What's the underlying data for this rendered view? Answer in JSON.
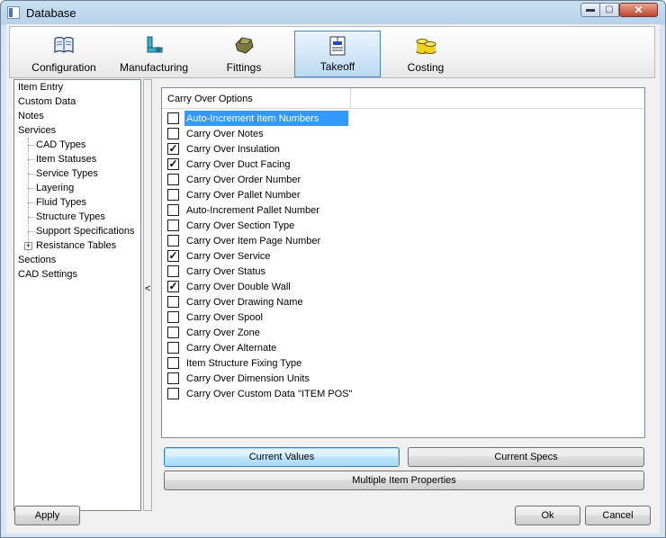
{
  "window": {
    "title": "Database"
  },
  "titlebar_buttons": {
    "minimize": "▬",
    "maximize": "▢",
    "close": "✕"
  },
  "tabs": [
    {
      "label": "Configuration",
      "icon": "book-icon"
    },
    {
      "label": "Manufacturing",
      "icon": "machine-icon"
    },
    {
      "label": "Fittings",
      "icon": "fitting-icon"
    },
    {
      "label": "Takeoff",
      "icon": "takeoff-icon",
      "active": true
    },
    {
      "label": "Costing",
      "icon": "coins-icon"
    }
  ],
  "tree": {
    "items": [
      "Item Entry",
      "Custom Data",
      "Notes",
      "Services",
      "CAD Types",
      "Item Statuses",
      "Service Types",
      "Layering",
      "Fluid Types",
      "Structure Types",
      "Support Specifications",
      "Resistance Tables",
      "Sections",
      "CAD Settings"
    ],
    "expander": "+"
  },
  "splitter": {
    "arrow": "<"
  },
  "panel": {
    "header": "Carry Over Options",
    "options": [
      {
        "label": "Auto-Increment Item Numbers",
        "checked": false,
        "selected": true
      },
      {
        "label": "Carry Over Notes",
        "checked": false
      },
      {
        "label": "Carry Over Insulation",
        "checked": true
      },
      {
        "label": "Carry Over Duct Facing",
        "checked": true
      },
      {
        "label": "Carry Over Order Number",
        "checked": false
      },
      {
        "label": "Carry Over Pallet Number",
        "checked": false
      },
      {
        "label": "Auto-Increment Pallet Number",
        "checked": false
      },
      {
        "label": "Carry Over Section Type",
        "checked": false
      },
      {
        "label": "Carry Over Item Page Number",
        "checked": false
      },
      {
        "label": "Carry Over Service",
        "checked": true
      },
      {
        "label": "Carry Over Status",
        "checked": false
      },
      {
        "label": "Carry Over Double Wall",
        "checked": true
      },
      {
        "label": "Carry Over Drawing Name",
        "checked": false
      },
      {
        "label": "Carry Over Spool",
        "checked": false
      },
      {
        "label": "Carry Over Zone",
        "checked": false
      },
      {
        "label": "Carry Over Alternate",
        "checked": false
      },
      {
        "label": "Item Structure Fixing Type",
        "checked": false
      },
      {
        "label": "Carry Over Dimension Units",
        "checked": false
      },
      {
        "label": "Carry Over Custom Data \"ITEM POS\"",
        "checked": false
      }
    ],
    "check_glyph": "✓"
  },
  "buttons": {
    "current_values": "Current Values",
    "current_specs": "Current Specs",
    "multiple_item_properties": "Multiple Item Properties",
    "apply": "Apply",
    "ok": "Ok",
    "cancel": "Cancel"
  }
}
